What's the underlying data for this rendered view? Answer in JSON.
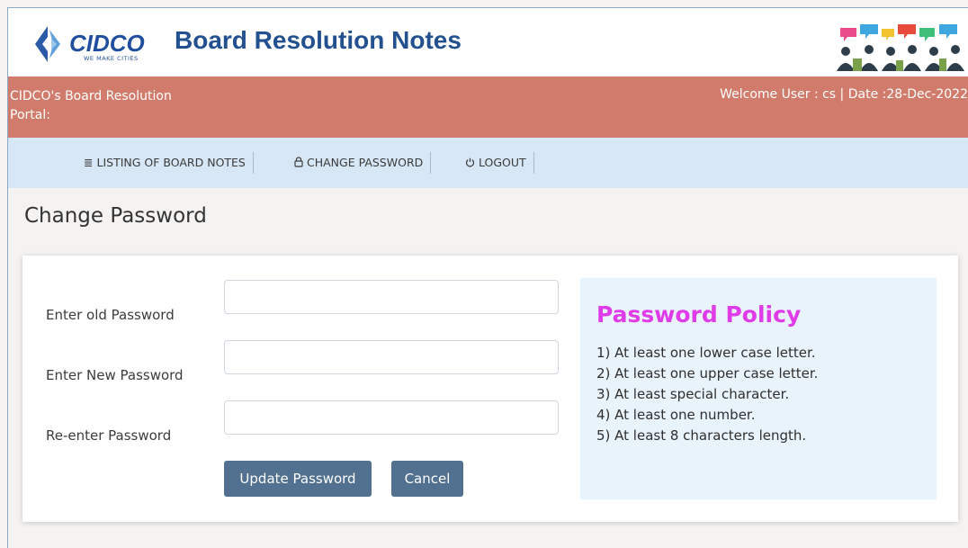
{
  "header": {
    "logo_text": "CIDCO",
    "logo_tagline": "WE MAKE CITIES",
    "title": "Board Resolution Notes"
  },
  "banner": {
    "portal_label": "CIDCO's Board Resolution Portal:",
    "welcome_text": "Welcome User : cs | Date :28-Dec-2022"
  },
  "nav": {
    "items": [
      {
        "icon": "list-icon",
        "glyph": "≣",
        "label": "LISTING OF BOARD NOTES"
      },
      {
        "icon": "lock-icon",
        "glyph": "🔒",
        "label": "CHANGE PASSWORD"
      },
      {
        "icon": "power-icon",
        "glyph": "⏻",
        "label": "LOGOUT"
      }
    ]
  },
  "page": {
    "title": "Change Password"
  },
  "form": {
    "old_password_label": "Enter old Password",
    "new_password_label": "Enter New Password",
    "reenter_password_label": "Re-enter Password",
    "old_password_value": "",
    "new_password_value": "",
    "reenter_password_value": "",
    "update_button": "Update Password",
    "cancel_button": "Cancel"
  },
  "policy": {
    "title": "Password Policy",
    "rules": [
      "1) At least one lower case letter.",
      "2) At least one upper case letter.",
      "3) At least special character.",
      "4) At least one number.",
      "5) At least 8 characters length."
    ]
  },
  "colors": {
    "brand_blue": "#23508f",
    "banner": "#d07b6b",
    "navbar": "#d7e7f5",
    "button": "#52708f",
    "policy_title": "#e03be8"
  }
}
